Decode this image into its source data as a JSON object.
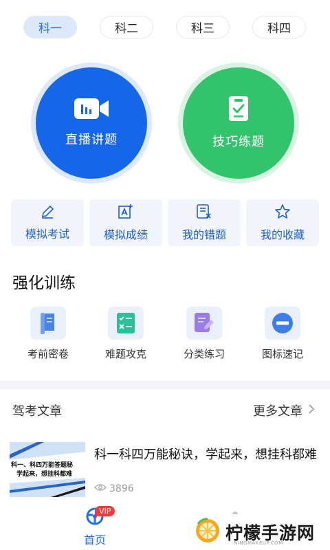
{
  "tabs": [
    {
      "label": "科一",
      "active": true
    },
    {
      "label": "科二",
      "active": false
    },
    {
      "label": "科三",
      "active": false
    },
    {
      "label": "科四",
      "active": false
    }
  ],
  "hero": {
    "live_label": "直播讲题",
    "skill_label": "技巧练题",
    "live_color": "#1667e8",
    "skill_color": "#32c36c"
  },
  "quick_cards": [
    {
      "label": "模拟考试",
      "icon": "pencil-icon"
    },
    {
      "label": "模拟成绩",
      "icon": "score-icon"
    },
    {
      "label": "我的错题",
      "icon": "wrong-list-icon"
    },
    {
      "label": "我的收藏",
      "icon": "star-icon"
    }
  ],
  "training": {
    "title": "强化训练",
    "items": [
      {
        "label": "考前密卷",
        "icon": "scroll-icon"
      },
      {
        "label": "难题攻克",
        "icon": "checklist-icon"
      },
      {
        "label": "分类练习",
        "icon": "edit-doc-icon"
      },
      {
        "label": "图标速记",
        "icon": "minus-circle-icon"
      }
    ]
  },
  "articles": {
    "header": "驾考文章",
    "more": "更多文章",
    "item": {
      "thumb_line1": "科一、科四万能答题秘",
      "thumb_line2": "学起来，想挂科都难",
      "title": "科一科四万能秘诀，学起来，想挂科都难",
      "views": "3896"
    }
  },
  "nav": {
    "home_label": "首页",
    "vip_badge": "VIP"
  },
  "watermark": {
    "text": "柠檬手游网",
    "sub": "NINGMAKEUP.COM"
  },
  "colors": {
    "accent": "#1d6fe6",
    "card_text": "#1d5fc8",
    "vip": "#f03a3a"
  }
}
